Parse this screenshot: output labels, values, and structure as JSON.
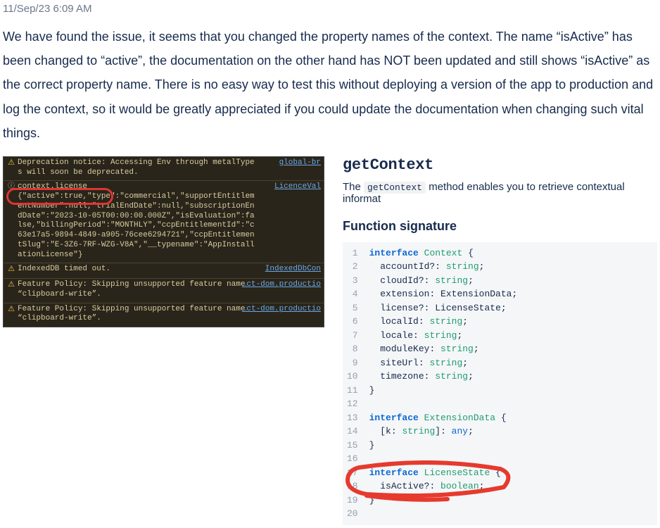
{
  "timestamp": "11/Sep/23 6:09 AM",
  "comment": "We have found the issue, it seems that you changed the property names of the context. The name “isActive” has been changed to “active”, the documentation on the other hand has NOT been updated and still shows “isActive” as the correct property name. There is no easy way to test this without deploying a version of the app to production and log the context, so it would be greatly appreciated if you could update the documentation when changing such vital things.",
  "console": {
    "rows": [
      {
        "icon": "warn",
        "msg": "Deprecation notice: Accessing Env through metalTypes will soon be deprecated.",
        "link": "global-br"
      },
      {
        "icon": "info",
        "header": "context.license",
        "json": "{\"active\":true,\"type\":\"commercial\",\"supportEntitlementNumber\":null,\"trialEndDate\":null,\"subscriptionEndDate\":\"2023-10-05T00:00:00.000Z\",\"isEvaluation\":false,\"billingPeriod\":\"MONTHLY\",\"ccpEntitlementId\":\"c63e17a5-9894-4849-a905-76cee6294721\",\"ccpEntitlementSlug\":\"E-3Z6-7RF-WZG-V8A\",\"__typename\":\"AppInstallationLicense\"}",
        "link": "LicenceVal"
      },
      {
        "icon": "warn",
        "msg": "IndexedDB timed out.",
        "link": "IndexedDbCon"
      },
      {
        "icon": "warn",
        "msg": "Feature Policy: Skipping unsupported feature name “clipboard-write”.",
        "link": "…ct-dom.productio"
      },
      {
        "icon": "warn",
        "msg": "Feature Policy: Skipping unsupported feature name “clipboard-write”.",
        "link": "…ct-dom.productio"
      }
    ]
  },
  "docs": {
    "heading": "getContext",
    "para_before": "The ",
    "para_code": "getContext",
    "para_after": " method enables you to retrieve contextual informat",
    "sig_heading": "Function signature",
    "code_lines": [
      [
        [
          "kw",
          "interface"
        ],
        [
          "sp",
          " "
        ],
        [
          "type",
          "Context"
        ],
        [
          "sp",
          " "
        ],
        [
          "punct",
          "{"
        ]
      ],
      [
        [
          "sp",
          "  "
        ],
        [
          "prop",
          "accountId?"
        ],
        [
          "punct",
          ": "
        ],
        [
          "type",
          "string"
        ],
        [
          "punct",
          ";"
        ]
      ],
      [
        [
          "sp",
          "  "
        ],
        [
          "prop",
          "cloudId?"
        ],
        [
          "punct",
          ": "
        ],
        [
          "type",
          "string"
        ],
        [
          "punct",
          ";"
        ]
      ],
      [
        [
          "sp",
          "  "
        ],
        [
          "prop",
          "extension"
        ],
        [
          "punct",
          ": "
        ],
        [
          "prop",
          "ExtensionData"
        ],
        [
          "punct",
          ";"
        ]
      ],
      [
        [
          "sp",
          "  "
        ],
        [
          "prop",
          "license?"
        ],
        [
          "punct",
          ": "
        ],
        [
          "prop",
          "LicenseState"
        ],
        [
          "punct",
          ";"
        ]
      ],
      [
        [
          "sp",
          "  "
        ],
        [
          "prop",
          "localId"
        ],
        [
          "punct",
          ": "
        ],
        [
          "type",
          "string"
        ],
        [
          "punct",
          ";"
        ]
      ],
      [
        [
          "sp",
          "  "
        ],
        [
          "prop",
          "locale"
        ],
        [
          "punct",
          ": "
        ],
        [
          "type",
          "string"
        ],
        [
          "punct",
          ";"
        ]
      ],
      [
        [
          "sp",
          "  "
        ],
        [
          "prop",
          "moduleKey"
        ],
        [
          "punct",
          ": "
        ],
        [
          "type",
          "string"
        ],
        [
          "punct",
          ";"
        ]
      ],
      [
        [
          "sp",
          "  "
        ],
        [
          "prop",
          "siteUrl"
        ],
        [
          "punct",
          ": "
        ],
        [
          "type",
          "string"
        ],
        [
          "punct",
          ";"
        ]
      ],
      [
        [
          "sp",
          "  "
        ],
        [
          "prop",
          "timezone"
        ],
        [
          "punct",
          ": "
        ],
        [
          "type",
          "string"
        ],
        [
          "punct",
          ";"
        ]
      ],
      [
        [
          "punct",
          "}"
        ]
      ],
      [
        [
          "sp",
          ""
        ]
      ],
      [
        [
          "kw",
          "interface"
        ],
        [
          "sp",
          " "
        ],
        [
          "type",
          "ExtensionData"
        ],
        [
          "sp",
          " "
        ],
        [
          "punct",
          "{"
        ]
      ],
      [
        [
          "sp",
          "  "
        ],
        [
          "punct",
          "["
        ],
        [
          "prop",
          "k"
        ],
        [
          "punct",
          ": "
        ],
        [
          "type",
          "string"
        ],
        [
          "punct",
          "]: "
        ],
        [
          "any",
          "any"
        ],
        [
          "punct",
          ";"
        ]
      ],
      [
        [
          "punct",
          "}"
        ]
      ],
      [
        [
          "sp",
          ""
        ]
      ],
      [
        [
          "kw",
          "interface"
        ],
        [
          "sp",
          " "
        ],
        [
          "type",
          "LicenseState"
        ],
        [
          "sp",
          " "
        ],
        [
          "punct",
          "{"
        ]
      ],
      [
        [
          "sp",
          "  "
        ],
        [
          "prop",
          "isActive?"
        ],
        [
          "punct",
          ": "
        ],
        [
          "type",
          "boolean"
        ],
        [
          "punct",
          ";"
        ]
      ],
      [
        [
          "punct",
          "}"
        ]
      ],
      [
        [
          "sp",
          ""
        ]
      ]
    ]
  }
}
